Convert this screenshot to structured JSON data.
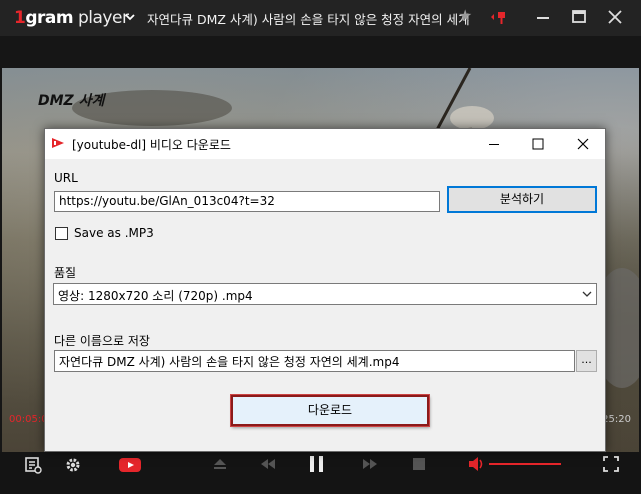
{
  "player": {
    "logo_prefix": "1",
    "logo_main": "gram",
    "logo_suffix": " player",
    "title": "자연다큐 DMZ 사계) 사람의 손을 타지 않은 청정 자연의 세계",
    "watermark": "DMZ 사계",
    "time_elapsed": "00:05:0",
    "time_total": "25:20",
    "accent_color": "#e5262b"
  },
  "dialog": {
    "title": "[youtube-dl]  비디오 다운로드",
    "url_label": "URL",
    "url_value": "https://youtu.be/GlAn_013c04?t=32",
    "analyze_button": "분석하기",
    "mp3_label": "Save as .MP3",
    "mp3_checked": false,
    "quality_label": "품질",
    "quality_selected": "영상: 1280x720 소리 (720p) .mp4",
    "saveas_label": "다른 이름으로 저장",
    "filename_value": "자연다큐 DMZ 사계) 사람의 손을 타지 않은 청정 자연의 세계.mp4",
    "browse_button": "...",
    "download_button": "다운로드"
  }
}
